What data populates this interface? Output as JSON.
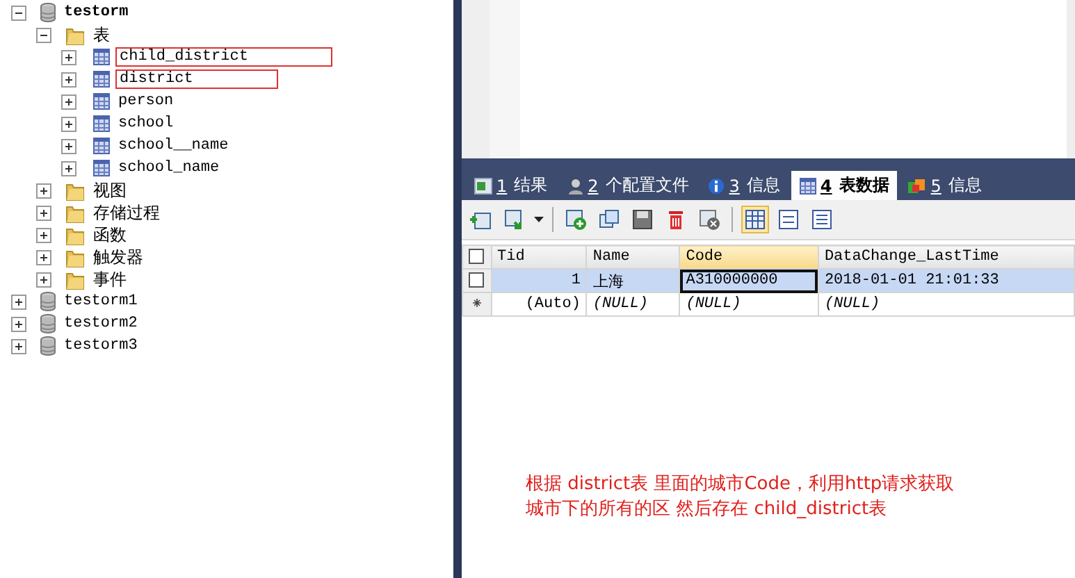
{
  "tree": [
    {
      "kind": "database",
      "label": "testorm",
      "expanded": true,
      "bold": true,
      "children": [
        {
          "kind": "folder",
          "label": "表",
          "expanded": true,
          "children": [
            {
              "kind": "table",
              "label": "child_district",
              "expanded": false,
              "highlighted": true
            },
            {
              "kind": "table",
              "label": "district",
              "expanded": false,
              "highlighted": true
            },
            {
              "kind": "table",
              "label": "person",
              "expanded": false,
              "highlighted": false
            },
            {
              "kind": "table",
              "label": "school",
              "expanded": false,
              "highlighted": false
            },
            {
              "kind": "table",
              "label": "school__name",
              "expanded": false,
              "highlighted": false
            },
            {
              "kind": "table",
              "label": "school_name",
              "expanded": false,
              "highlighted": false
            }
          ]
        },
        {
          "kind": "folder",
          "label": "视图",
          "expanded": false
        },
        {
          "kind": "folder",
          "label": "存储过程",
          "expanded": false
        },
        {
          "kind": "folder",
          "label": "函数",
          "expanded": false
        },
        {
          "kind": "folder",
          "label": "触发器",
          "expanded": false
        },
        {
          "kind": "folder",
          "label": "事件",
          "expanded": false
        }
      ]
    },
    {
      "kind": "database",
      "label": "testorm1",
      "expanded": false,
      "bold": false
    },
    {
      "kind": "database",
      "label": "testorm2",
      "expanded": false,
      "bold": false
    },
    {
      "kind": "database",
      "label": "testorm3",
      "expanded": false,
      "bold": false
    }
  ],
  "result_tabs": [
    {
      "kind": "result",
      "key": "1",
      "label": "结果",
      "selected": false
    },
    {
      "kind": "profile",
      "key": "2",
      "label": "个配置文件",
      "selected": false
    },
    {
      "kind": "info",
      "key": "3",
      "label": "信息",
      "selected": false
    },
    {
      "kind": "tabledata",
      "key": "4",
      "label": "表数据",
      "selected": true
    },
    {
      "kind": "history",
      "key": "5",
      "label": "信息",
      "selected": false
    }
  ],
  "view_modes": [
    {
      "selected": true
    },
    {
      "selected": false
    },
    {
      "selected": false
    }
  ],
  "grid": {
    "all_checked": false,
    "columns": [
      "Tid",
      "Name",
      "Code",
      "DataChange_LastTime"
    ],
    "rows": [
      {
        "kind": "data",
        "selected": true,
        "checked": false,
        "cells": [
          {
            "text": "1",
            "focused": false
          },
          {
            "text": "上海",
            "focused": false
          },
          {
            "text": "A310000000",
            "focused": true
          },
          {
            "text": "2018-01-01 21:01:33",
            "focused": false
          }
        ]
      },
      {
        "kind": "new",
        "selected": false,
        "cells": [
          {
            "text": "(Auto)",
            "focused": false
          },
          {
            "text": "(NULL)",
            "focused": false
          },
          {
            "text": "(NULL)",
            "focused": false
          },
          {
            "text": "(NULL)",
            "focused": false
          }
        ]
      }
    ]
  },
  "annotation": [
    "根据 district表 里面的城市Code，利用http请求获取",
    "城市下的所有的区 然后存在 child_district表"
  ]
}
